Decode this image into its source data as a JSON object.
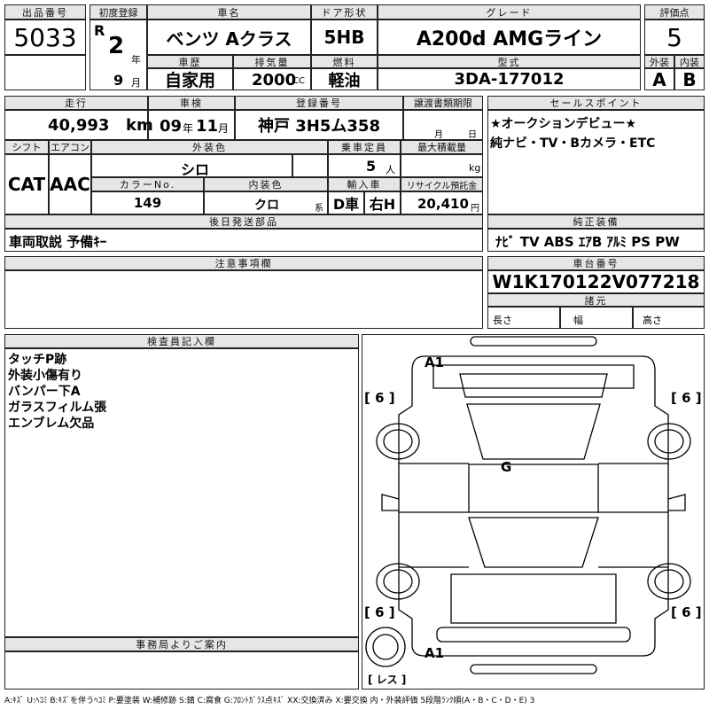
{
  "labels": {
    "lot_no": "出品番号",
    "first_reg": "初度登録",
    "car_name": "車名",
    "door": "ドア形状",
    "grade": "グレード",
    "score": "評価点",
    "history": "車歴",
    "displacement": "排気量",
    "fuel": "燃料",
    "model": "型式",
    "ext": "外装",
    "int": "内装",
    "mileage": "走行",
    "inspection": "車検",
    "reg_no": "登録番号",
    "transfer": "譲渡書類期限",
    "sales_point": "セールスポイント",
    "shift": "シフト",
    "aircon": "エアコン",
    "ext_color": "外装色",
    "capacity": "乗車定員",
    "max_load": "最大積載量",
    "color_no": "カラーNo.",
    "int_color": "内装色",
    "import": "輸入車",
    "recycle": "リサイクル預託金",
    "later_parts": "後日発送部品",
    "genuine": "純正装備",
    "notes": "注意事項欄",
    "chassis": "車台番号",
    "specs": "諸元",
    "length": "長さ",
    "width": "幅",
    "height": "高さ",
    "inspector": "検査員記入欄",
    "office": "事務局よりご案内",
    "year_unit": "年",
    "month_unit": "月",
    "cc": "CC",
    "km": "km",
    "kg": "kg",
    "persons": "人",
    "yen": "円",
    "kei": "系",
    "month_short": "月",
    "day_short": "日"
  },
  "values": {
    "lot_no": "5033",
    "era": "R",
    "year": "2",
    "month": "9",
    "car_name": "ベンツ Aクラス",
    "door": "5HB",
    "grade": "A200d AMGライン",
    "score": "5",
    "history": "自家用",
    "displacement": "2000",
    "fuel": "軽油",
    "model": "3DA-177012",
    "ext_score": "A",
    "int_score": "B",
    "mileage": "40,993",
    "insp_year": "09",
    "insp_year_unit": "年",
    "insp_month": "11",
    "insp_month_unit": "月",
    "reg_no": "神戸 3H5ム358",
    "sales_point_1": "★オークションデビュー★",
    "sales_point_2": "純ナビ・TV・Bカメラ・ETC",
    "shift": "CAT",
    "aircon": "AAC",
    "ext_color": "シロ",
    "capacity": "5",
    "color_no": "149",
    "int_color": "クロ",
    "import_1": "D車",
    "import_2": "右H",
    "recycle": "20,410",
    "later_parts": "車両取説 予備ｷｰ",
    "genuine": "ﾅﾋﾞ TV ABS ｴｱB ｱﾙﾐ PS PW",
    "chassis": "W1K170122V077218"
  },
  "inspector_notes": [
    "タッチP跡",
    "外装小傷有り",
    "バンパー下A",
    "ガラスフィルム張",
    "エンブレム欠品"
  ],
  "diagram": {
    "a1_top": "A1",
    "a1_bottom": "A1",
    "g": "G",
    "tire_fl": "[ 6 ]",
    "tire_fr": "[ 6 ]",
    "tire_rl": "[ 6 ]",
    "tire_rr": "[ 6 ]",
    "spare": "[ レス ]"
  },
  "legend": "A:ｷｽﾞ U:ﾍｺﾐ B:ｷｽﾞを伴うﾍｺﾐ P:要塗装 W:補修跡 S:錆 C:腐食 G:ﾌﾛﾝﾄｶﾞﾗｽ点ｷｽﾞ XX:交換済み X:要交換  内・外装評価 5段階ﾗﾝｸ順(A・B・C・D・E) 3"
}
